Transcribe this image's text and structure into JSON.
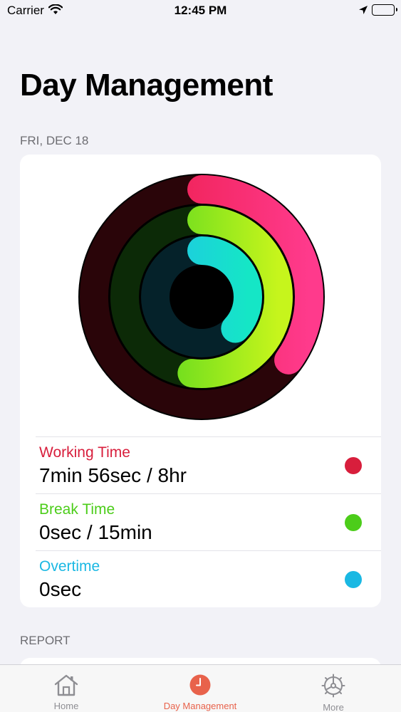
{
  "status_bar": {
    "carrier": "Carrier",
    "time": "12:45 PM"
  },
  "page_title": "Day Management",
  "date_header": "FRI, DEC 18",
  "rings": {
    "working_progress": 0.35,
    "break_progress": 0.52,
    "overtime_progress": 0.37,
    "colors": {
      "working": "#e8163d",
      "working_end": "#ff3a8c",
      "working_track": "#2a0509",
      "break": "#4ad31f",
      "break_end": "#c6f51c",
      "break_track": "#0c2a07",
      "overtime": "#1fc6e6",
      "overtime_end": "#15e6c6",
      "overtime_track": "#05222a"
    }
  },
  "metrics": [
    {
      "label": "Working Time",
      "value": "7min 56sec / 8hr",
      "color": "#d81e3c"
    },
    {
      "label": "Break Time",
      "value": "0sec / 15min",
      "color": "#4ccd1a"
    },
    {
      "label": "Overtime",
      "value": "0sec",
      "color": "#1ab8e3"
    }
  ],
  "report_header": "REPORT",
  "tabs": [
    {
      "label": "Home"
    },
    {
      "label": "Day Management"
    },
    {
      "label": "More"
    }
  ]
}
